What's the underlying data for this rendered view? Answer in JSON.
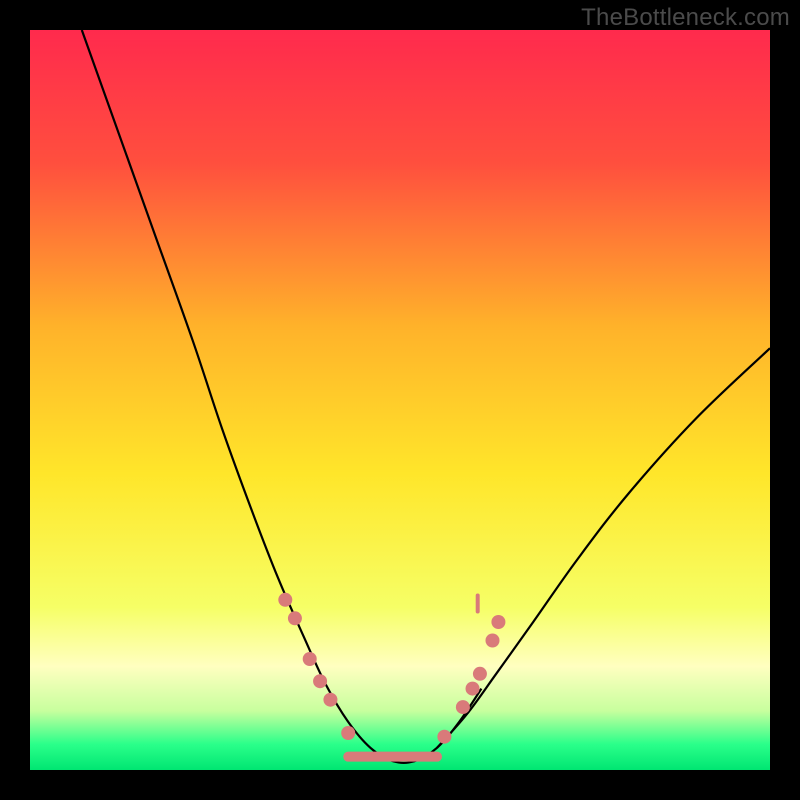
{
  "watermark": "TheBottleneck.com",
  "chart_data": {
    "type": "line",
    "title": "",
    "xlabel": "",
    "ylabel": "",
    "xlim": [
      0,
      100
    ],
    "ylim": [
      0,
      100
    ],
    "gradient_stops": [
      {
        "offset": 0.0,
        "color": "#ff2a4d"
      },
      {
        "offset": 0.18,
        "color": "#ff4f3e"
      },
      {
        "offset": 0.4,
        "color": "#ffb22a"
      },
      {
        "offset": 0.6,
        "color": "#ffe62a"
      },
      {
        "offset": 0.78,
        "color": "#f6ff66"
      },
      {
        "offset": 0.86,
        "color": "#ffffc0"
      },
      {
        "offset": 0.92,
        "color": "#c8ff9e"
      },
      {
        "offset": 0.965,
        "color": "#2bff8a"
      },
      {
        "offset": 1.0,
        "color": "#00e672"
      }
    ],
    "series": [
      {
        "name": "left-curve",
        "color": "#000000",
        "width": 2.2,
        "points": [
          {
            "x": 7.0,
            "y": 100.0
          },
          {
            "x": 12.0,
            "y": 86.0
          },
          {
            "x": 17.0,
            "y": 72.0
          },
          {
            "x": 22.0,
            "y": 58.0
          },
          {
            "x": 26.0,
            "y": 46.0
          },
          {
            "x": 30.0,
            "y": 35.0
          },
          {
            "x": 33.5,
            "y": 26.0
          },
          {
            "x": 37.0,
            "y": 18.0
          },
          {
            "x": 40.0,
            "y": 11.5
          },
          {
            "x": 43.0,
            "y": 6.5
          },
          {
            "x": 46.0,
            "y": 3.0
          },
          {
            "x": 49.0,
            "y": 1.2
          },
          {
            "x": 52.0,
            "y": 1.2
          },
          {
            "x": 55.0,
            "y": 3.0
          },
          {
            "x": 58.0,
            "y": 6.5
          },
          {
            "x": 61.0,
            "y": 11.0
          }
        ]
      },
      {
        "name": "right-curve",
        "color": "#000000",
        "width": 2.2,
        "points": [
          {
            "x": 55.0,
            "y": 3.0
          },
          {
            "x": 59.0,
            "y": 7.5
          },
          {
            "x": 63.0,
            "y": 13.0
          },
          {
            "x": 68.0,
            "y": 20.0
          },
          {
            "x": 74.0,
            "y": 28.5
          },
          {
            "x": 81.0,
            "y": 37.5
          },
          {
            "x": 90.0,
            "y": 47.5
          },
          {
            "x": 100.0,
            "y": 57.0
          }
        ]
      },
      {
        "name": "trough-flat",
        "color": "#d97a7a",
        "width": 10,
        "cap": "round",
        "points": [
          {
            "x": 43.0,
            "y": 1.8
          },
          {
            "x": 55.0,
            "y": 1.8
          }
        ]
      }
    ],
    "markers": {
      "color": "#d97a7a",
      "radius": 7,
      "points_left": [
        {
          "x": 34.5,
          "y": 23.0
        },
        {
          "x": 35.8,
          "y": 20.5
        },
        {
          "x": 37.8,
          "y": 15.0
        },
        {
          "x": 39.2,
          "y": 12.0
        },
        {
          "x": 40.6,
          "y": 9.5
        },
        {
          "x": 43.0,
          "y": 5.0
        }
      ],
      "points_right": [
        {
          "x": 56.0,
          "y": 4.5
        },
        {
          "x": 58.5,
          "y": 8.5
        },
        {
          "x": 59.8,
          "y": 11.0
        },
        {
          "x": 60.8,
          "y": 13.0
        },
        {
          "x": 62.5,
          "y": 17.5
        },
        {
          "x": 63.3,
          "y": 20.0
        }
      ],
      "tick_right": {
        "x": 60.5,
        "y": 22.5,
        "h": 8
      }
    }
  }
}
